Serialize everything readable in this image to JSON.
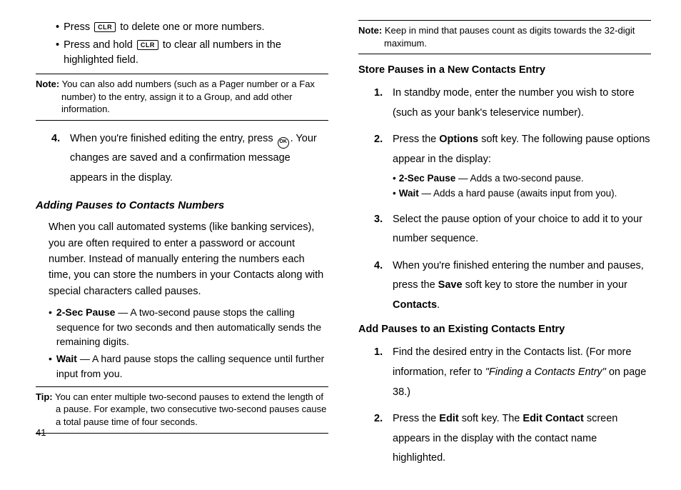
{
  "left": {
    "bullets": [
      {
        "pre": "Press ",
        "key": "CLR",
        "post": " to delete one or more numbers."
      },
      {
        "pre": "Press and hold ",
        "key": "CLR",
        "post": " to clear all numbers in the highlighted field."
      }
    ],
    "note1_label": "Note:",
    "note1_text": " You can also add numbers (such as a Pager number or a Fax number) to the entry, assign it to a Group, and add other information.",
    "step4_num": "4.",
    "step4_pre": "When you're finished editing the entry, press ",
    "step4_icon": "OK",
    "step4_post": ". Your changes are saved and a confirmation message appears in the display.",
    "pauses_heading": "Adding Pauses to Contacts Numbers",
    "pauses_para": "When you call automated systems (like banking services), you are often required to enter a password or account number. Instead of manually entering the numbers each time, you can store the numbers in your Contacts along with special characters called pauses.",
    "defs": [
      {
        "term": "2-Sec Pause",
        "text": " — A two-second pause stops the calling sequence for two seconds and then automatically sends the remaining digits."
      },
      {
        "term": "Wait",
        "text": " — A hard pause stops the calling sequence until further input from you."
      }
    ],
    "tip_label": "Tip:",
    "tip_text": " You can enter multiple two-second pauses to extend the length of a pause. For example, two consecutive two-second pauses cause a total pause time of four seconds."
  },
  "right": {
    "note_label": "Note:",
    "note_text": " Keep in mind that pauses count as digits towards the 32-digit maximum.",
    "store_heading": "Store Pauses in a New Contacts Entry",
    "store_steps": [
      {
        "n": "1.",
        "text": "In standby mode, enter the number you wish to store (such as your bank's teleservice number)."
      },
      {
        "n": "2.",
        "pre": "Press the ",
        "b1": "Options",
        "post": " soft key. The following pause options appear in the display:",
        "subs": [
          {
            "term": "2-Sec Pause",
            "text": " — Adds a two-second pause."
          },
          {
            "term": "Wait",
            "text": " — Adds a hard pause (awaits input from you)."
          }
        ]
      },
      {
        "n": "3.",
        "text": "Select the pause option of your choice to add it to your number sequence."
      },
      {
        "n": "4.",
        "pre": "When you're finished entering the number and pauses, press the ",
        "b1": "Save",
        "mid": " soft key to store the number in your ",
        "b2": "Contacts",
        "post": "."
      }
    ],
    "add_heading": "Add Pauses to an Existing Contacts Entry",
    "add_steps": [
      {
        "n": "1.",
        "pre": "Find the desired entry in the Contacts list. (For more information, refer to ",
        "ital": "\"Finding a Contacts Entry\"",
        "post": "  on page 38.)"
      },
      {
        "n": "2.",
        "pre": "Press the ",
        "b1": "Edit",
        "mid": " soft key. The ",
        "b2": "Edit Contact",
        "post": " screen appears in the display with the contact name highlighted."
      }
    ]
  },
  "page_number": "41"
}
